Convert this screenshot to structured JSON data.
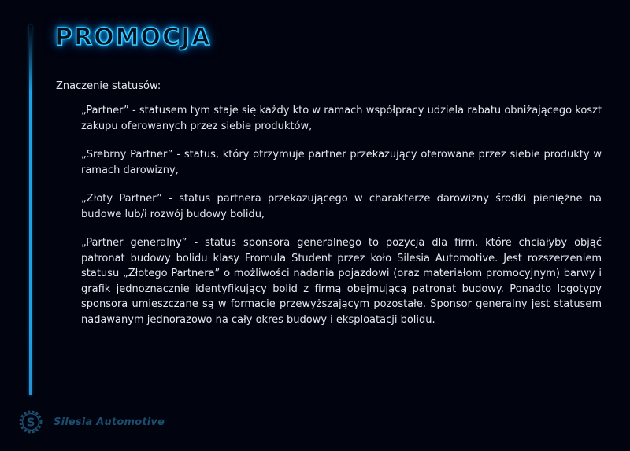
{
  "title": "PROMOCJA",
  "intro": "Znaczenie statusów:",
  "statuses": [
    {
      "text": "„Partner” - statusem tym staje się każdy kto w ramach współpracy udziela rabatu obniżającego koszt zakupu oferowanych przez siebie produktów,"
    },
    {
      "text": "„Srebrny Partner” - status, który otrzymuje partner przekazujący oferowane przez siebie produkty w ramach darowizny,"
    },
    {
      "text": "„Złoty Partner” - status partnera przekazującego w charakterze darowizny środki pieniężne na budowe lub/i rozwój budowy bolidu,"
    },
    {
      "text": "„Partner generalny” - status sponsora generalnego to pozycja dla firm, które chciałyby objąć patronat budowy bolidu klasy Fromula Student przez koło Silesia Automotive. Jest rozszerzeniem statusu „Złotego Partnera” o możliwości nadania pojazdowi (oraz materiałom promocyjnym) barwy i grafik jednoznacznie identyfikujący bolid z firmą obejmującą patronat budowy. Ponadto logotypy sponsora umieszczane są w formacie przewyższającym pozostałe. Sponsor generalny jest statusem nadawanym jednorazowo na cały okres budowy i eksploatacji bolidu."
    }
  ],
  "logo": {
    "name": "Silesia Automotive",
    "mark_letter": "S"
  },
  "colors": {
    "background": "#01030f",
    "accent": "#1fa0e6",
    "text": "#e6e8ee",
    "logo": "#1d4d6e"
  }
}
